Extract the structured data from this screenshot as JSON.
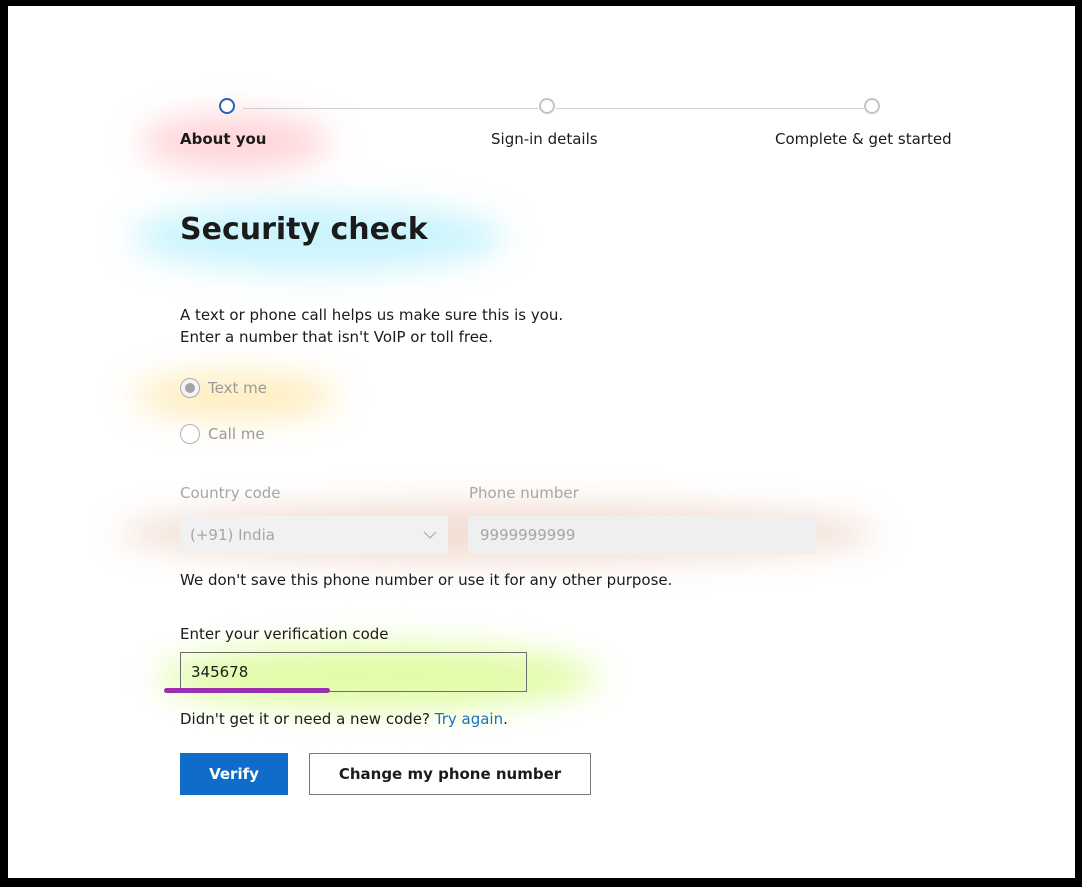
{
  "stepper": {
    "steps": [
      {
        "label": "About you",
        "active": true
      },
      {
        "label": "Sign-in details",
        "active": false
      },
      {
        "label": "Complete & get started",
        "active": false
      }
    ]
  },
  "page": {
    "title": "Security check",
    "description_line1": "A text or phone call helps us make sure this is you.",
    "description_line2": "Enter a number that isn't VoIP or toll free."
  },
  "contact_method": {
    "options": [
      {
        "label": "Text me",
        "selected": true
      },
      {
        "label": "Call me",
        "selected": false
      }
    ]
  },
  "country_code": {
    "label": "Country code",
    "value": "(+91) India"
  },
  "phone_number": {
    "label": "Phone number",
    "value": "9999999999"
  },
  "privacy_note": "We don't save this phone number or use it for any other purpose.",
  "verification": {
    "label": "Enter your verification code",
    "value": "345678",
    "resend_text": "Didn't get it or need a new code?",
    "resend_link": "Try again",
    "resend_suffix": "."
  },
  "buttons": {
    "verify": "Verify",
    "change_phone": "Change my phone number"
  },
  "colors": {
    "primary": "#0f6cc9",
    "link": "#1f6fbf",
    "active_step": "#1f63b6",
    "annotation_underline": "#9a2fb0"
  }
}
